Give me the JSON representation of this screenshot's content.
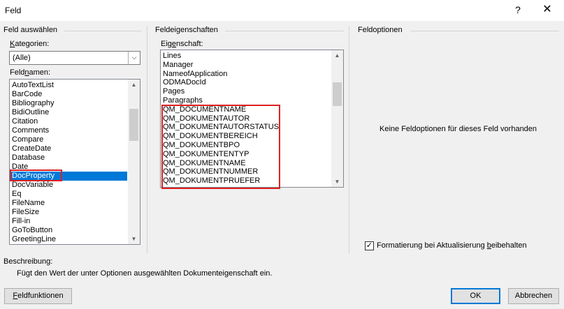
{
  "window": {
    "title": "Feld",
    "help": "?",
    "close": "✕"
  },
  "select_field": {
    "group_title": "Feld auswählen",
    "categories_label": "Kategorien:",
    "categories_value": "(Alle)",
    "fieldnames_label": "Feldnamen:",
    "fieldnames": [
      "AutoTextList",
      "BarCode",
      "Bibliography",
      "BidiOutline",
      "Citation",
      "Comments",
      "Compare",
      "CreateDate",
      "Database",
      "Date",
      "DocProperty",
      "DocVariable",
      "Eq",
      "FileName",
      "FileSize",
      "Fill-in",
      "GoToButton",
      "GreetingLine"
    ],
    "selected_fieldname": "DocProperty"
  },
  "field_properties": {
    "group_title": "Feldeigenschaften",
    "property_label": "Eigenschaft:",
    "properties": [
      "Lines",
      "Manager",
      "NameofApplication",
      "ODMADocId",
      "Pages",
      "Paragraphs",
      "QM_DOCUMENTNAME",
      "QM_DOKUMENTAUTOR",
      "QM_DOKUMENTAUTORSTATUS",
      "QM_DOKUMENTBEREICH",
      "QM_DOKUMENTBPO",
      "QM_DOKUMENTENTYP",
      "QM_DOKUMENTNAME",
      "QM_DOKUMENTNUMMER",
      "QM_DOKUMENTPRUEFER"
    ]
  },
  "field_options": {
    "group_title": "Feldoptionen",
    "empty_message": "Keine Feldoptionen für dieses Feld vorhanden",
    "preserve_formatting_label": "Formatierung bei Aktualisierung beibehalten",
    "preserve_formatting_checked": true
  },
  "description": {
    "label": "Beschreibung:",
    "text": "Fügt den Wert der unter Optionen ausgewählten Dokumenteigenschaft ein."
  },
  "buttons": {
    "field_codes": "Feldfunktionen",
    "ok": "OK",
    "cancel": "Abbrechen"
  },
  "colors": {
    "selection": "#0078d7",
    "highlight_box": "#e02020"
  }
}
